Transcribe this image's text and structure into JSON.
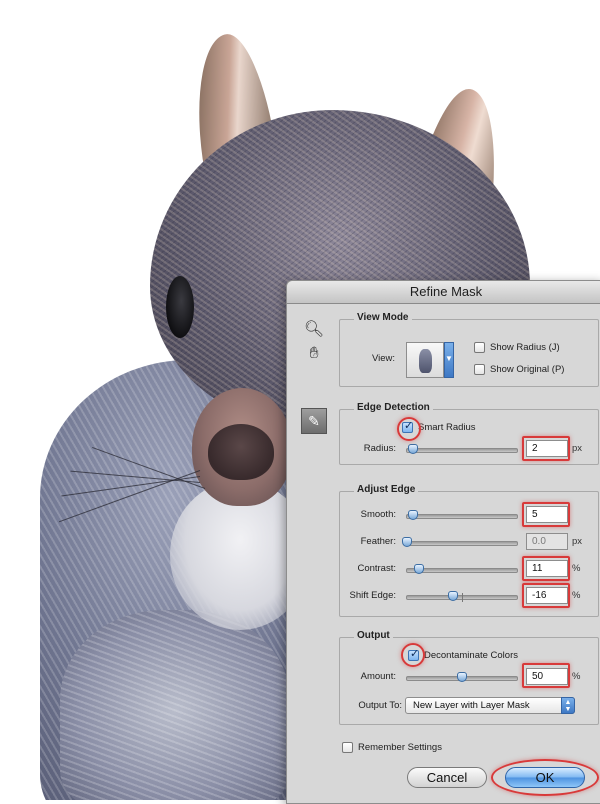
{
  "dialog": {
    "title": "Refine Mask",
    "tools": {
      "zoom": "zoom-tool-icon",
      "hand": "hand-tool-icon",
      "refine_brush": "refine-radius-brush-icon"
    },
    "view_mode": {
      "title": "View Mode",
      "view_label": "View:",
      "show_radius_label": "Show Radius (J)",
      "show_radius_checked": false,
      "show_original_label": "Show Original (P)",
      "show_original_checked": false
    },
    "edge_detection": {
      "title": "Edge Detection",
      "smart_radius_label": "Smart Radius",
      "smart_radius_checked": true,
      "radius_label": "Radius:",
      "radius_value": "2",
      "radius_unit": "px",
      "radius_level": 0.05
    },
    "adjust_edge": {
      "title": "Adjust Edge",
      "smooth_label": "Smooth:",
      "smooth_value": "5",
      "smooth_level": 0.05,
      "feather_label": "Feather:",
      "feather_value": "0.0",
      "feather_unit": "px",
      "feather_level": 0.0,
      "contrast_label": "Contrast:",
      "contrast_value": "11",
      "contrast_unit": "%",
      "contrast_level": 0.11,
      "shift_edge_label": "Shift Edge:",
      "shift_edge_value": "-16",
      "shift_edge_unit": "%",
      "shift_edge_level": 0.42
    },
    "output": {
      "title": "Output",
      "decontaminate_label": "Decontaminate Colors",
      "decontaminate_checked": true,
      "amount_label": "Amount:",
      "amount_value": "50",
      "amount_unit": "%",
      "amount_level": 0.5,
      "output_to_label": "Output To:",
      "output_to_value": "New Layer with Layer Mask"
    },
    "remember_settings_label": "Remember Settings",
    "remember_settings_checked": false,
    "cancel_label": "Cancel",
    "ok_label": "OK"
  },
  "colors": {
    "highlight": "#d83a3a",
    "accent": "#4d92e0"
  }
}
